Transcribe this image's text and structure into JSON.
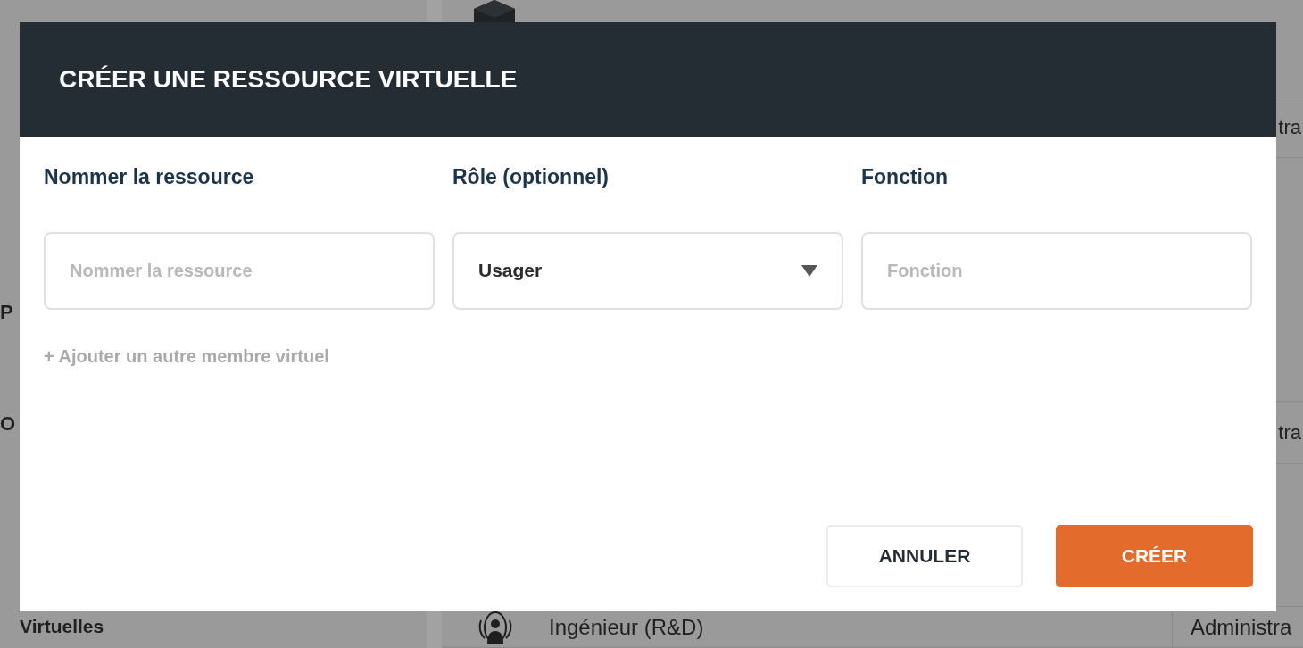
{
  "page_behind": {
    "sidebar_items": [
      {
        "text": "P"
      },
      {
        "text": "O"
      },
      {
        "text": "Virtuelles"
      }
    ],
    "list_rows": [
      {
        "column_2": "tra"
      },
      {
        "column_2": "tra"
      },
      {
        "name": "Ingénieur (R&D)",
        "column_2": "Administra"
      }
    ]
  },
  "dialog": {
    "title": "CRÉER UNE RESSOURCE VIRTUELLE",
    "fields": [
      {
        "kind": "text",
        "label": "Nommer la ressource",
        "placeholder": "Nommer la ressource"
      },
      {
        "kind": "select",
        "label": "Rôle (optionnel)",
        "value": "Usager"
      },
      {
        "kind": "text",
        "label": "Fonction",
        "placeholder": "Fonction"
      }
    ],
    "add_link": "+ Ajouter un autre membre virtuel",
    "buttons": [
      {
        "kind": "secondary",
        "label": "ANNULER"
      },
      {
        "kind": "primary",
        "label": "CRÉER"
      }
    ]
  }
}
